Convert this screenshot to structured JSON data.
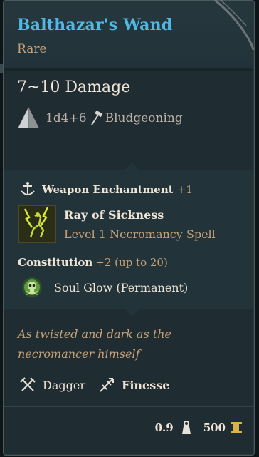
{
  "item": {
    "name": "Balthazar's Wand",
    "rarity": "Rare",
    "damage": "7~10 Damage",
    "dice": "1d4+6",
    "damage_type": "Bludgeoning"
  },
  "enchantment": {
    "label": "Weapon Enchantment",
    "bonus": "+1"
  },
  "spell": {
    "name": "Ray of Sickness",
    "level": "Level 1 Necromancy Spell"
  },
  "constitution": {
    "label": "Constitution",
    "bonus": "+2 (up to 20)"
  },
  "passive": {
    "label": "Soul Glow  (Permanent)"
  },
  "flavor": "As twisted and dark as the necromancer himself",
  "properties": [
    {
      "label": "Dagger",
      "icon": "crossed-daggers-icon"
    },
    {
      "label": "Finesse",
      "icon": "finesse-icon"
    }
  ],
  "footer": {
    "weight": "0.9",
    "value": "500"
  },
  "colors": {
    "title": "#4fb8e6",
    "accent": "#c6a27a",
    "text": "#efe4d5",
    "panel": "#1f2c31"
  }
}
